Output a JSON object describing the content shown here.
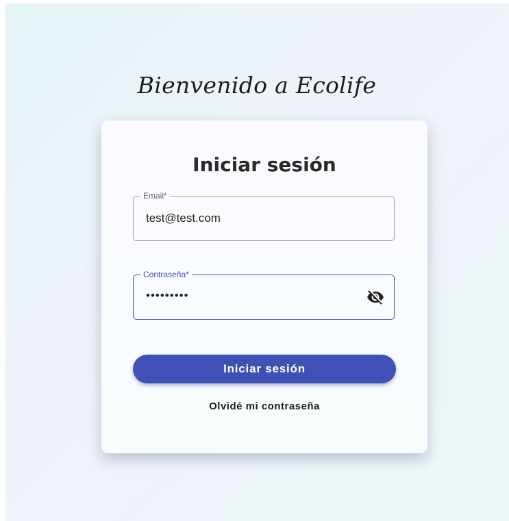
{
  "welcome": "Bienvenido a Ecolife",
  "login": {
    "title": "Iniciar sesión",
    "email": {
      "label": "Email*",
      "value": "test@test.com"
    },
    "password": {
      "label": "Contraseña*",
      "value": "•••••••••"
    },
    "submit_label": "Iniciar sesión",
    "forgot_label": "Olvidé mi contraseña"
  },
  "icons": {
    "visibility_toggle": "visibility-off-icon"
  },
  "colors": {
    "accent": "#3f51b5"
  }
}
